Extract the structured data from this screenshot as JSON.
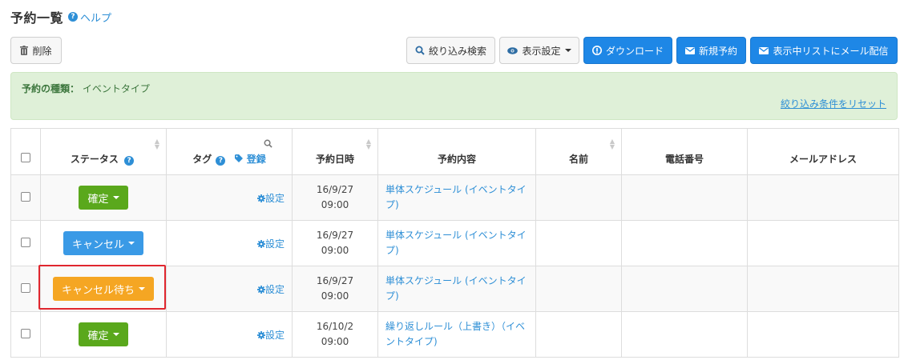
{
  "header": {
    "title": "予約一覧",
    "help_label": "ヘルプ"
  },
  "toolbar": {
    "delete_label": "削除",
    "filter_search_label": "絞り込み検索",
    "display_settings_label": "表示設定",
    "download_label": "ダウンロード",
    "new_reservation_label": "新規予約",
    "mail_label": "表示中リストにメール配信"
  },
  "filter": {
    "label": "予約の種類：",
    "value": "イベントタイプ",
    "reset_label": "絞り込み条件をリセット"
  },
  "table": {
    "headers": {
      "status": "ステータス",
      "tag": "タグ",
      "tag_register": "登録",
      "date": "予約日時",
      "content": "予約内容",
      "name": "名前",
      "phone": "電話番号",
      "email": "メールアドレス"
    },
    "settings_label": "設定",
    "rows": [
      {
        "status": "確定",
        "status_color": "#5aa81c",
        "date_line1": "16/9/27",
        "date_line2": "09:00",
        "content": "単体スケジュール (イベントタイプ)",
        "name": "",
        "phone": "",
        "email": ""
      },
      {
        "status": "キャンセル",
        "status_color": "#3a9ae6",
        "date_line1": "16/9/27",
        "date_line2": "09:00",
        "content": "単体スケジュール (イベントタイプ)",
        "name": "",
        "phone": "",
        "email": ""
      },
      {
        "status": "キャンセル待ち",
        "status_color": "#f5a623",
        "date_line1": "16/9/27",
        "date_line2": "09:00",
        "content": "単体スケジュール (イベントタイプ)",
        "name": "",
        "phone": "",
        "email": ""
      },
      {
        "status": "確定",
        "status_color": "#5aa81c",
        "date_line1": "16/10/2",
        "date_line2": "09:00",
        "content": "繰り返しルール（上書き）（イベントタイプ)",
        "name": "",
        "phone": "",
        "email": ""
      }
    ]
  },
  "colors": {
    "primary": "#1e87e6",
    "link": "#2e8fd6",
    "highlight_border": "#e0262e"
  }
}
